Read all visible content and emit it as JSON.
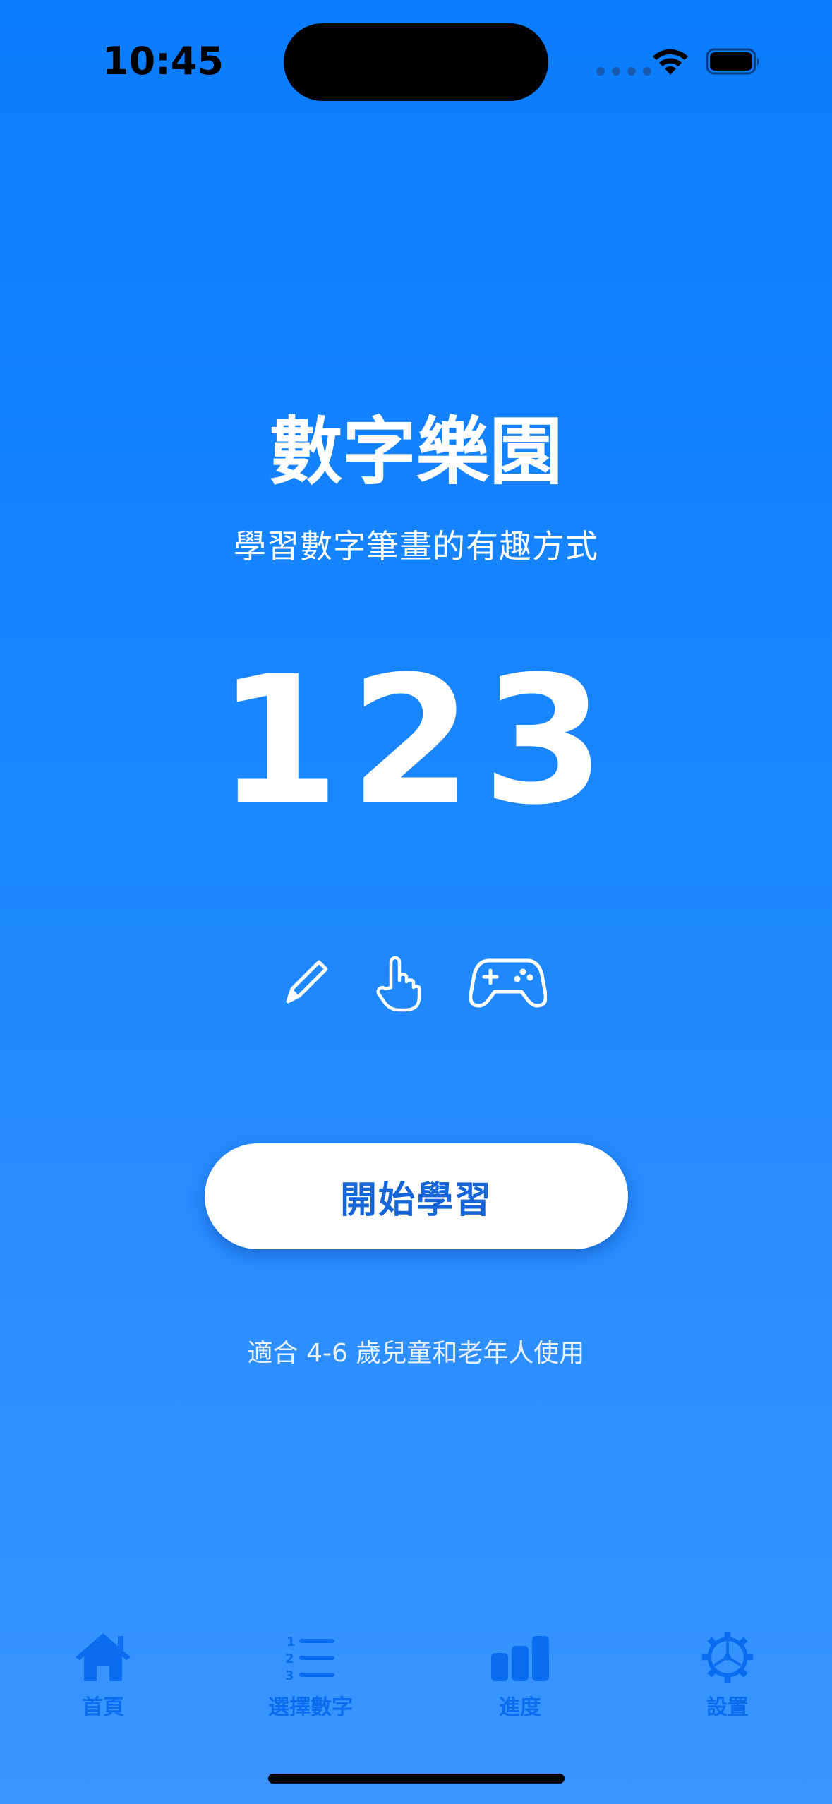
{
  "status_bar": {
    "time": "10:45"
  },
  "main": {
    "title": "數字樂園",
    "subtitle": "學習數字筆畫的有趣方式",
    "numbers": "123",
    "feature_icons": [
      "pencil-icon",
      "hand-point-icon",
      "gamepad-icon"
    ],
    "start_button_label": "開始學習",
    "age_note": "適合 4-6 歲兒童和老年人使用"
  },
  "tab_bar": {
    "items": [
      {
        "label": "首頁",
        "icon": "house-icon"
      },
      {
        "label": "選擇數字",
        "icon": "numbered-list-icon"
      },
      {
        "label": "進度",
        "icon": "bar-chart-icon"
      },
      {
        "label": "設置",
        "icon": "gear-icon"
      }
    ]
  },
  "colors": {
    "background_top": "#0A7CFF",
    "background_bottom": "#3A95FF",
    "accent": "#1565D8",
    "tab_tint": "#0A6DF0"
  }
}
